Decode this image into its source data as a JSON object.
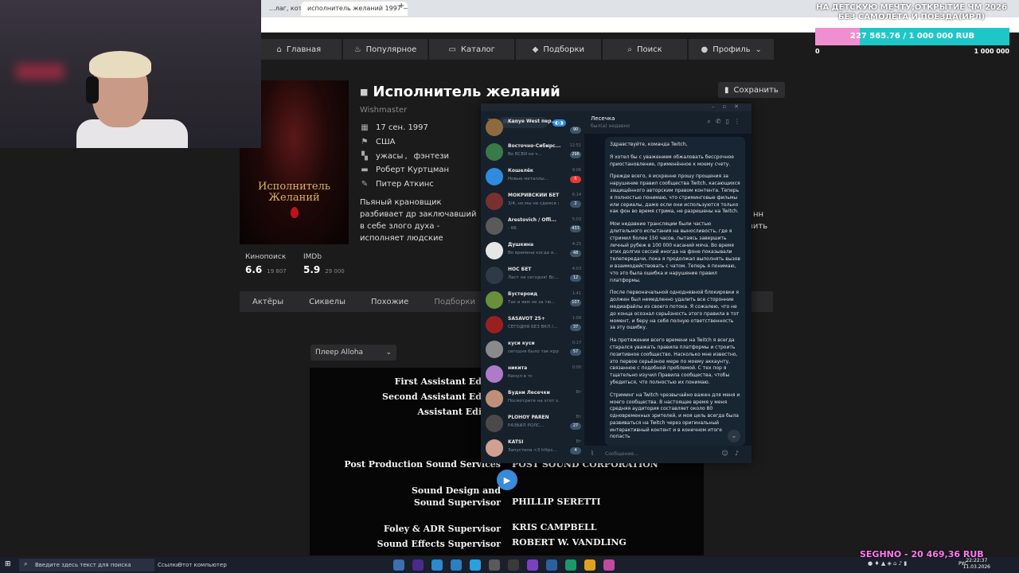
{
  "browser": {
    "tabs": [
      "...лаг, которые и...",
      "исполнитель желаний 1997 — Я..."
    ]
  },
  "nav": [
    {
      "label": "Главная",
      "icon": "home-icon"
    },
    {
      "label": "Популярное",
      "icon": "fire-icon"
    },
    {
      "label": "Каталог",
      "icon": "catalog-icon"
    },
    {
      "label": "Подборки",
      "icon": "collections-icon"
    },
    {
      "label": "Поиск",
      "icon": "search-icon"
    },
    {
      "label": "Профиль",
      "icon": "profile-icon"
    }
  ],
  "movie": {
    "title": "Исполнитель желаний",
    "original_title": "Wishmaster",
    "poster_text": "Исполнитель Желаний",
    "save_label": "Сохранить",
    "date": "17 сен. 1997",
    "country": "США",
    "genre1": "ужасы",
    "genre2": "фэнтези",
    "director": "Роберт Куртцман",
    "writer": "Питер Аткинс",
    "description": "Пьяный крановщик разбивает др заключавший в себе злого духа - исполняет людские желания, заб три желания человека, пробудив",
    "kp_label": "Кинопоиск",
    "kp_value": "6.6",
    "kp_count": "19 807",
    "imdb_label": "IMDb",
    "imdb_value": "5.9",
    "imdb_count": "29 000",
    "side_text1": "нн",
    "side_text2": "вить"
  },
  "movie_tabs": [
    "Актёры",
    "Сиквелы",
    "Похожие",
    "Подборки"
  ],
  "player": {
    "selector": "Плеер Alloha",
    "credits": [
      {
        "role": "First Assistant Ed",
        "name": ""
      },
      {
        "role": "Second Assistant Ed",
        "name": ""
      },
      {
        "role": "Assistant Edi",
        "name": ""
      },
      {
        "role": "Post Production Sound Services",
        "name": "POST SOUND CORPORATION"
      },
      {
        "role": "Sound Design and",
        "name": ""
      },
      {
        "role": "Sound Supervisor",
        "name": "PHILLIP SERETTI"
      },
      {
        "role": "Foley & ADR Supervisor",
        "name": "KRIS CAMPBELL"
      },
      {
        "role": "Sound Effects Supervisor",
        "name": "ROBERT W. VANDLING"
      }
    ]
  },
  "goal": {
    "title": "НА ДЕТСКУЮ МЕЧТУ,ОТКРЫТИЕ ЧМ 2026 БЕЗ САМОЛЕТА И ПОЕЗДА(ИРЛ)",
    "progress_text": "227 565.76 / 1 000 000 RUB",
    "progress_fraction": 0.2276,
    "min": "0",
    "max": "1 000 000"
  },
  "telegram": {
    "search_placeholder": "Поиск",
    "chats": [
      {
        "name": "Kanye West пер...",
        "time": "",
        "preview": "",
        "badge": "90",
        "color": "#8e6b3e"
      },
      {
        "name": "Восточно-Сибирс...",
        "time": "12:51",
        "preview": "Во ВСЕЙ ке ч...",
        "badge": "296",
        "color": "#3a7a4a"
      },
      {
        "name": "Кошелёк",
        "time": "9:06",
        "preview": "Новые металлы...",
        "badge": "6",
        "color": "#2f8be0",
        "red": true
      },
      {
        "name": "МОКРИВСКИЙ БЕТ",
        "time": "6:14",
        "preview": "3/4, но мы не сдемся з...",
        "badge": "2",
        "color": "#7a3030"
      },
      {
        "name": "Arestovich / Offi...",
        "time": "5:03",
        "preview": "- 66.",
        "badge": "433",
        "color": "#5a5a5a"
      },
      {
        "name": "Душкина",
        "time": "4:25",
        "preview": "Во времена когда я...",
        "badge": "48",
        "color": "#e6e6e6"
      },
      {
        "name": "НОС БЕТ",
        "time": "4:03",
        "preview": "Ласт на сегодня! Вс...",
        "badge": "12",
        "color": "#2e3a48"
      },
      {
        "name": "Бустероид",
        "time": "1:41",
        "preview": "Так и явм не за тю...",
        "badge": "107",
        "color": "#6a8f3a"
      },
      {
        "name": "SASAVOT 25+",
        "time": "1:09",
        "preview": "СЕГОДНЯ БЕЗ ВКЛ /...",
        "badge": "37",
        "color": "#9a2020"
      },
      {
        "name": "куси куси",
        "time": "0:17",
        "preview": "сегодня было так круг...",
        "badge": "57",
        "color": "#8a8a8a"
      },
      {
        "name": "никита",
        "time": "0:00",
        "preview": "Кинул в тс",
        "badge": "",
        "color": "#b07acb"
      },
      {
        "name": "Будни Лесечки",
        "time": "Вт",
        "preview": "Посмотрите на этот з...",
        "badge": "",
        "color": "#c08f7a"
      },
      {
        "name": "PLOHOY PAREN",
        "time": "Вт",
        "preview": "РАЗБИЛ РОЛС...",
        "badge": "27",
        "color": "#4a4a4a"
      },
      {
        "name": "KATSI",
        "time": "Вт",
        "preview": "Запустила <3 https...",
        "badge": "4",
        "color": "#d0a090"
      }
    ],
    "contact_name": "Лесечка",
    "contact_status": "был(а) недавно",
    "message_paragraphs": [
      "Здравствуйте, команда Twitch,",
      "Я хотел бы с уважением обжаловать бессрочное приостановление, применённое к моему счету.",
      "Прежде всего, я искренне прошу прощения за нарушение правил сообщества Twitch, касающихся защищённого авторским правом контента. Теперь я полностью понимаю, что стриминговые фильмы или сериалы, даже если они используются только как фон во время стрима, не разрешены на Twitch.",
      "Мои недавние трансляции были частью длительного испытания на выносливость, где я стримил более 150 часов, пытаясь завершить личный рубеж в 100 000 касаний мяча. Во время этих долгих сессий иногда на фоне показывали телепередачи, пока я продолжал выполнять вызов и взаимодействовать с чатом. Теперь я понимаю, что это была ошибка и нарушение правил платформы.",
      "После первоначальной однодневной блокировки я должен был немедленно удалить все сторонние медиафайлы из своего потока. Я сожалею, что не до конца осознал серьёзность этого правила в тот момент, и беру на себя полную ответственность за эту ошибку.",
      "На протяжении всего времени на Twitch я всегда старался уважать правила платформы и строить позитивное сообщество. Насколько мне известно, это первое серьёзное мере по моему аккаунту, связанное с подобной проблемой. С тех пор я тщательно изучил Правила сообщества, чтобы убедиться, что полностью их понимаю.",
      "Стриминг на Twitch чрезвычайно важен для меня и моего сообщества. В настоящее время у меня средняя аудитория составляет около 80 одновременных зрителей, и моя цель всегда была развиваться на Twitch через оригинальный интерактивный контент и в конечном итоге попасть"
    ],
    "input_placeholder": "Сообщение..."
  },
  "taskbar": {
    "search_placeholder": "Введите здесь текст для поиска",
    "links_label": "Ссылки",
    "this_pc": "Этот компьютер",
    "lang": "РУС",
    "time": "22:22:37",
    "date": "11.03.2026"
  },
  "donation_ticker": "SEGHNO - 20 469,36 RUB"
}
